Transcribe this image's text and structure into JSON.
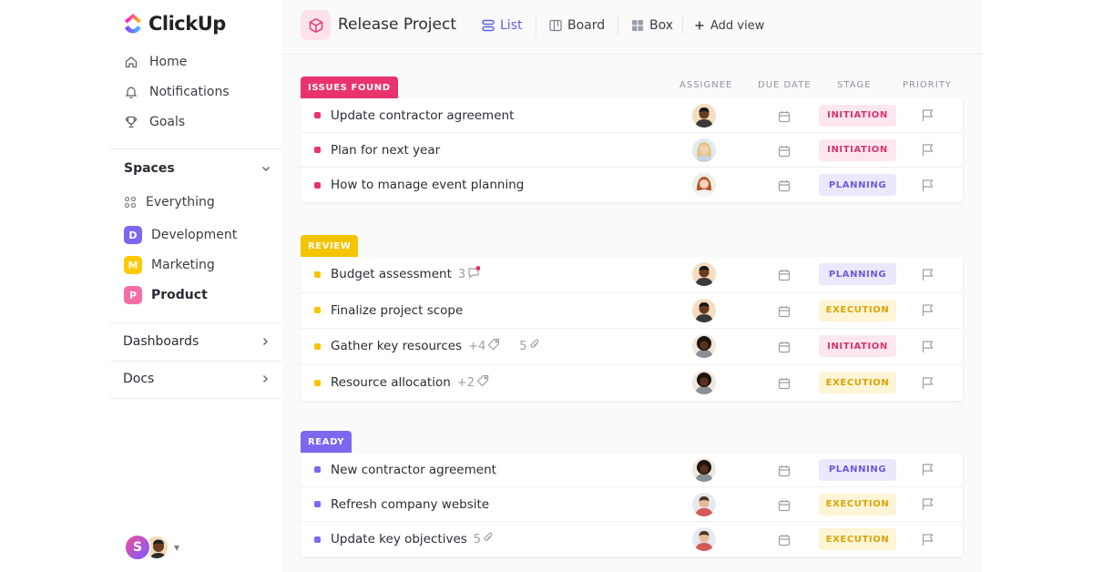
{
  "app": {
    "name": "ClickUp"
  },
  "sidebar": {
    "nav": [
      {
        "label": "Home",
        "icon": "home-icon"
      },
      {
        "label": "Notifications",
        "icon": "bell-icon"
      },
      {
        "label": "Goals",
        "icon": "trophy-icon"
      }
    ],
    "spaces_label": "Spaces",
    "everything_label": "Everything",
    "spaces": [
      {
        "letter": "D",
        "label": "Development",
        "color": "#7b68ee"
      },
      {
        "letter": "M",
        "label": "Marketing",
        "color": "#ffc800"
      },
      {
        "letter": "P",
        "label": "Product",
        "color": "#f46da3"
      }
    ],
    "sections": [
      {
        "label": "Dashboards"
      },
      {
        "label": "Docs"
      }
    ],
    "user_initial": "S"
  },
  "header": {
    "title": "Release Project",
    "views": [
      {
        "label": "List",
        "active": true
      },
      {
        "label": "Board",
        "active": false
      },
      {
        "label": "Box",
        "active": false
      }
    ],
    "add_view": "Add view"
  },
  "columns": {
    "assignee": "ASSIGNEE",
    "due_date": "DUE DATE",
    "stage": "STAGE",
    "priority": "PRIORITY"
  },
  "groups": [
    {
      "label": "ISSUES FOUND",
      "color": "#e8336c",
      "tasks": [
        {
          "name": "Update contractor agreement",
          "stage": "INITIATION",
          "stage_class": "initiation",
          "avatar": "man-dark"
        },
        {
          "name": "Plan for next year",
          "stage": "INITIATION",
          "stage_class": "initiation",
          "avatar": "woman-blonde"
        },
        {
          "name": "How to manage event planning",
          "stage": "PLANNING",
          "stage_class": "planning",
          "avatar": "woman-red"
        }
      ]
    },
    {
      "label": "REVIEW",
      "color": "#f5c400",
      "tasks": [
        {
          "name": "Budget assessment",
          "stage": "PLANNING",
          "stage_class": "planning",
          "avatar": "man-dark",
          "meta": "3"
        },
        {
          "name": "Finalize project scope",
          "stage": "EXECUTION",
          "stage_class": "execution",
          "avatar": "man-dark"
        },
        {
          "name": "Gather key resources",
          "stage": "INITIATION",
          "stage_class": "initiation",
          "avatar": "man-curly",
          "meta": "+4",
          "meta2": "5"
        },
        {
          "name": "Resource allocation",
          "stage": "EXECUTION",
          "stage_class": "execution",
          "avatar": "man-curly",
          "meta": "+2"
        }
      ]
    },
    {
      "label": "READY",
      "color": "#7b68ee",
      "tasks": [
        {
          "name": "New contractor agreement",
          "stage": "PLANNING",
          "stage_class": "planning",
          "avatar": "man-curly"
        },
        {
          "name": "Refresh company website",
          "stage": "EXECUTION",
          "stage_class": "execution",
          "avatar": "man-light"
        },
        {
          "name": "Update key objectives",
          "stage": "EXECUTION",
          "stage_class": "execution",
          "avatar": "man-light",
          "meta": "5"
        }
      ]
    }
  ]
}
